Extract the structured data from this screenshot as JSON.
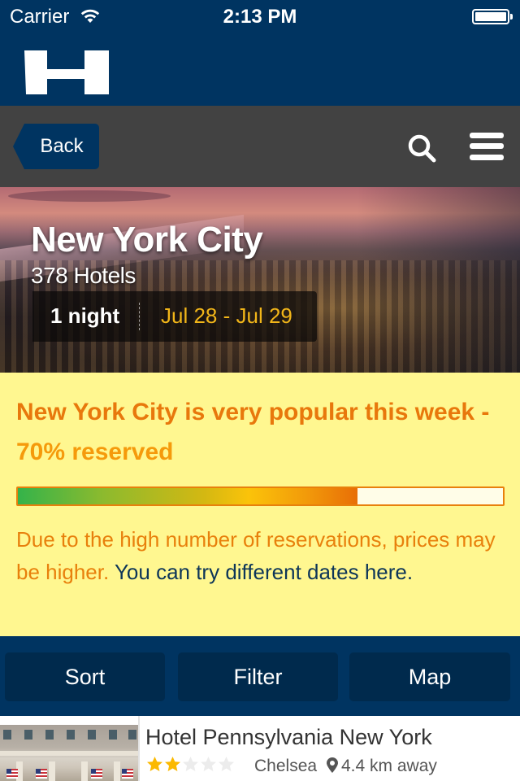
{
  "status_bar": {
    "carrier": "Carrier",
    "time": "2:13 PM",
    "battery_level": 1.0
  },
  "header": {
    "logo_icon": "hotel-h-logo"
  },
  "navbar": {
    "back_label": "Back",
    "search_icon": "search-icon",
    "menu_icon": "hamburger-menu-icon"
  },
  "hero": {
    "city": "New York City",
    "hotel_count": "378 Hotels",
    "nights": "1 night",
    "dates": "Jul 28 - Jul 29"
  },
  "notice": {
    "headline_main": "New York City is very popular this week - ",
    "headline_pct": "70% reserved",
    "reserved_percent": 70,
    "body_main": "Due to the high number of reservations, prices may be higher. ",
    "body_link": "You can try different dates here."
  },
  "actions": [
    {
      "label": "Sort"
    },
    {
      "label": "Filter"
    },
    {
      "label": "Map"
    }
  ],
  "hotels": [
    {
      "name": "Hotel Pennsylvania New York",
      "stars": 2,
      "max_stars": 5,
      "neighborhood": "Chelsea",
      "distance": "4.4 km away"
    }
  ],
  "colors": {
    "brand_navy": "#003461",
    "nav_gray": "#424242",
    "notice_bg": "#fff790",
    "notice_orange": "#e8780c",
    "date_gold": "#f2b619",
    "link_navy": "#0d3558",
    "star_gold": "#fbb900"
  }
}
